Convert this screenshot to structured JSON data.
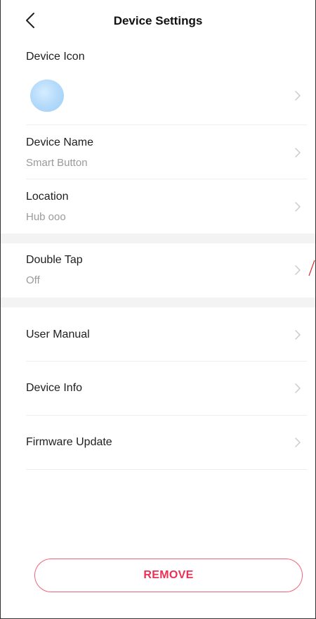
{
  "header": {
    "title": "Device Settings",
    "back_icon": "chevron-left-icon"
  },
  "device_icon": {
    "label": "Device Icon",
    "icon_color": "#b7dcfb"
  },
  "device_name": {
    "label": "Device Name",
    "value": "Smart Button"
  },
  "location": {
    "label": "Location",
    "value": "Hub ooo"
  },
  "double_tap": {
    "label": "Double Tap",
    "value": "Off"
  },
  "user_manual": {
    "label": "User Manual"
  },
  "device_info": {
    "label": "Device Info"
  },
  "firmware_update": {
    "label": "Firmware Update"
  },
  "remove_button": {
    "label": "REMOVE",
    "color": "#ec2f55"
  },
  "colors": {
    "section_gap": "#f3f3f3",
    "divider": "#eeeeee",
    "chevron": "#c8c8c8"
  }
}
